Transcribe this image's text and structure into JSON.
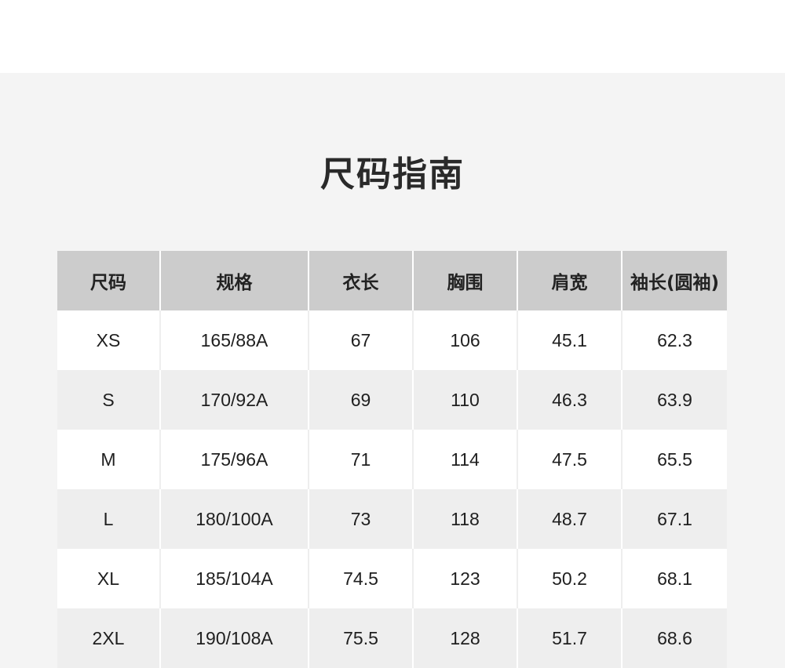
{
  "title": "尺码指南",
  "table": {
    "headers": [
      "尺码",
      "规格",
      "衣长",
      "胸围",
      "肩宽",
      "袖长(圆袖)"
    ],
    "rows": [
      [
        "XS",
        "165/88A",
        "67",
        "106",
        "45.1",
        "62.3"
      ],
      [
        "S",
        "170/92A",
        "69",
        "110",
        "46.3",
        "63.9"
      ],
      [
        "M",
        "175/96A",
        "71",
        "114",
        "47.5",
        "65.5"
      ],
      [
        "L",
        "180/100A",
        "73",
        "118",
        "48.7",
        "67.1"
      ],
      [
        "XL",
        "185/104A",
        "74.5",
        "123",
        "50.2",
        "68.1"
      ],
      [
        "2XL",
        "190/108A",
        "75.5",
        "128",
        "51.7",
        "68.6"
      ]
    ]
  },
  "colors": {
    "header_bg": "#cccccc",
    "panel_bg": "#f4f4f4",
    "row_alt_bg": "#eeeeee",
    "row_bg": "#ffffff",
    "text": "#1f1f1f"
  }
}
